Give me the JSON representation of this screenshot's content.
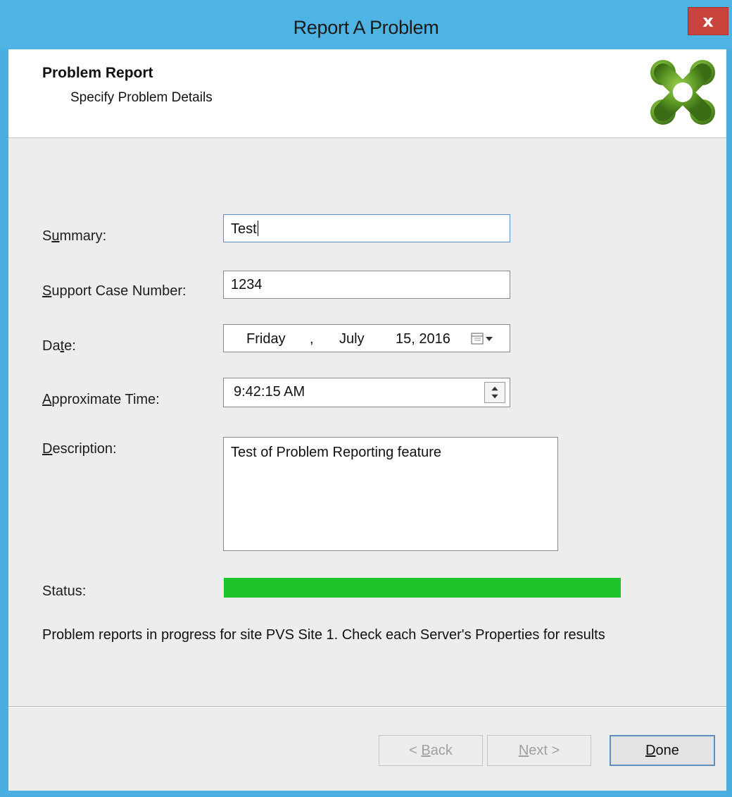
{
  "window": {
    "title": "Report A Problem",
    "close_label": "x"
  },
  "header": {
    "title": "Problem Report",
    "subtitle": "Specify Problem Details"
  },
  "form": {
    "summary_label": {
      "pre": "S",
      "u": "u",
      "post": "mmary:"
    },
    "summary_value": "Test",
    "case_label": {
      "pre": "",
      "u": "S",
      "post": "upport Case Number:"
    },
    "case_value": "1234",
    "date_label": {
      "pre": "Da",
      "u": "t",
      "post": "e:"
    },
    "date": {
      "weekday": "Friday",
      "comma": ",",
      "month": "July",
      "day_year": "15, 2016"
    },
    "time_label": {
      "pre": "",
      "u": "A",
      "post": "pproximate Time:"
    },
    "time_value": "9:42:15 AM",
    "description_label": {
      "pre": "",
      "u": "D",
      "post": "escription:"
    },
    "description_value": "Test of Problem Reporting feature",
    "status_label": "Status:",
    "status_progress": 1.0
  },
  "status_message": "Problem reports in progress for site PVS Site 1. Check each Server's Properties for results",
  "buttons": {
    "back": {
      "pre": "< ",
      "u": "B",
      "post": "ack"
    },
    "next": {
      "pre": "",
      "u": "N",
      "post": "ext >"
    },
    "done": {
      "pre": "",
      "u": "D",
      "post": "one"
    }
  },
  "colors": {
    "titlebar": "#4fb3e4",
    "close": "#c9443c",
    "progress": "#1ec32a",
    "logo": "#6aa82e"
  },
  "icons": {
    "logo": "citrix-logo-icon",
    "calendar": "calendar-dropdown-icon",
    "spinner": "spinner-updown-icon"
  }
}
